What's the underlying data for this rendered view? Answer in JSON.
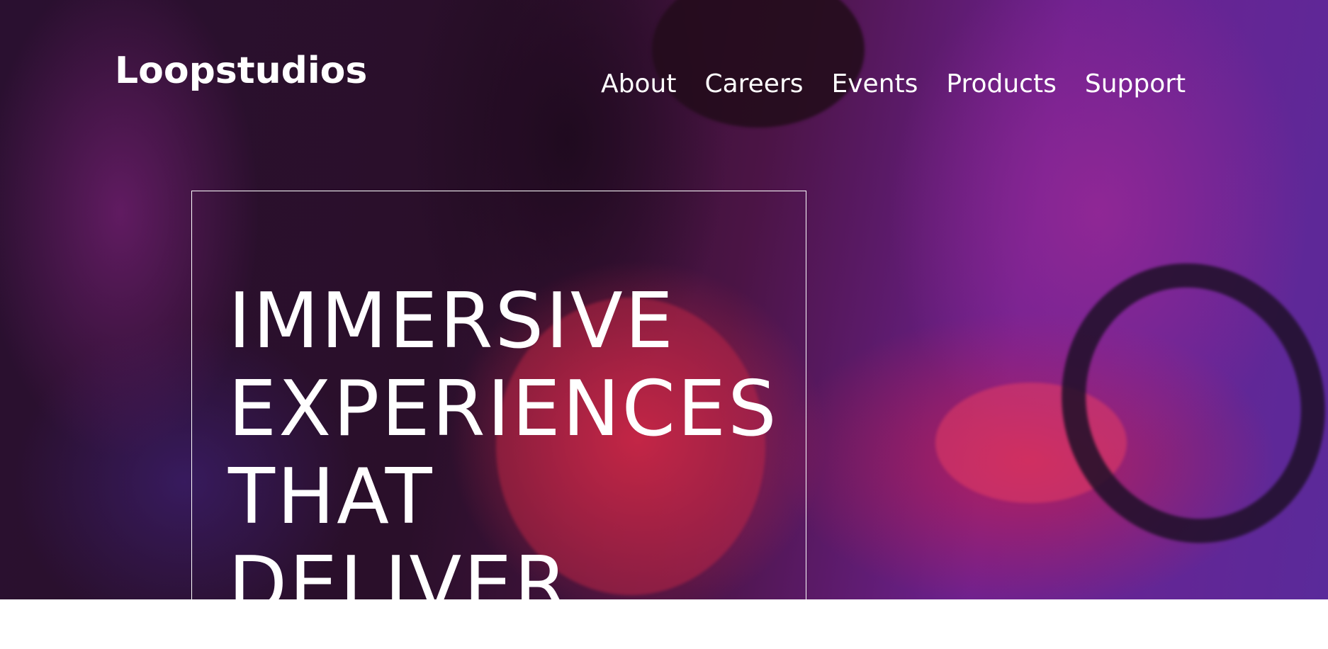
{
  "brand": {
    "name": "Loopstudios"
  },
  "nav": {
    "items": [
      {
        "label": "About"
      },
      {
        "label": "Careers"
      },
      {
        "label": "Events"
      },
      {
        "label": "Products"
      },
      {
        "label": "Support"
      }
    ]
  },
  "hero": {
    "title_lines": [
      "IMMERSIVE",
      "EXPERIENCES",
      "THAT",
      "DELIVER"
    ]
  },
  "colors": {
    "text": "#ffffff",
    "page_background": "#ffffff",
    "hero_tint": "#6d2190"
  }
}
